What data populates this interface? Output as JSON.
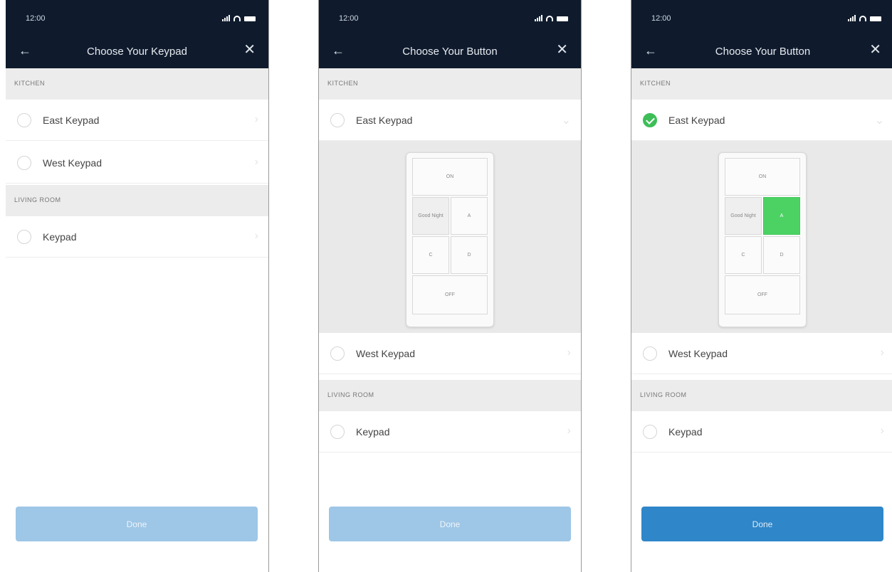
{
  "status_time": "12:00",
  "screens": [
    {
      "title": "Choose Your Keypad",
      "sections": [
        "KITCHEN",
        "LIVING ROOM"
      ],
      "rows": [
        "East Keypad",
        "West Keypad",
        "Keypad"
      ],
      "done_label": "Done",
      "done_enabled": false
    },
    {
      "title": "Choose Your Button",
      "sections": [
        "KITCHEN",
        "LIVING ROOM"
      ],
      "rows": [
        "East Keypad",
        "West Keypad",
        "Keypad"
      ],
      "keypad_buttons": [
        "ON",
        "Good Night",
        "A",
        "C",
        "D",
        "OFF"
      ],
      "done_label": "Done",
      "done_enabled": false
    },
    {
      "title": "Choose Your Button",
      "sections": [
        "KITCHEN",
        "LIVING ROOM"
      ],
      "rows": [
        "East Keypad",
        "West Keypad",
        "Keypad"
      ],
      "selected_row": "East Keypad",
      "keypad_buttons": [
        "ON",
        "Good Night",
        "A",
        "C",
        "D",
        "OFF"
      ],
      "selected_button": "A",
      "done_label": "Done",
      "done_enabled": true
    }
  ],
  "colors": {
    "header": "#0f1b2d",
    "section_bg": "#ececec",
    "done_disabled": "#9ec6e6",
    "done_active": "#2f86c9",
    "selected_green": "#4cd263"
  },
  "icons": [
    "back-arrow-icon",
    "close-icon",
    "chevron-right-icon",
    "signal-icon",
    "wifi-icon",
    "battery-icon",
    "checkmark-icon"
  ]
}
